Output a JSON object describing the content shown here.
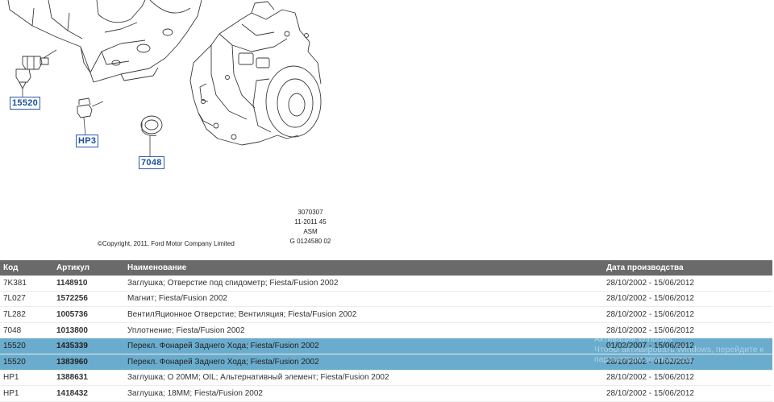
{
  "diagram": {
    "callouts": [
      "15520",
      "HP3",
      "7048"
    ],
    "stamp_lines": [
      "3070307",
      "11-2011 45",
      "ASM",
      "G 0124580 02"
    ],
    "copyright": "©Copyright, 2011, Ford Motor Company Limited"
  },
  "table": {
    "headers": {
      "code": "Код",
      "article": "Артикул",
      "name": "Наименование",
      "date": "Дата производства"
    },
    "rows": [
      {
        "code": "7K381",
        "article": "1148910",
        "name": "Заглушка; Отверстие под спидометр; Fiesta/Fusion 2002",
        "date": "28/10/2002 - 15/06/2012"
      },
      {
        "code": "7L027",
        "article": "1572256",
        "name": "Магнит; Fiesta/Fusion 2002",
        "date": "28/10/2002 - 15/06/2012"
      },
      {
        "code": "7L282",
        "article": "1005736",
        "name": "ВентилЯционное Отверстие; Вентиляция; Fiesta/Fusion 2002",
        "date": "28/10/2002 - 15/06/2012"
      },
      {
        "code": "7048",
        "article": "1013800",
        "name": "Уплотнение; Fiesta/Fusion 2002",
        "date": "28/10/2002 - 15/06/2012"
      },
      {
        "code": "15520",
        "article": "1435339",
        "name": "Перекл. Фонарей Заднего Хода; Fiesta/Fusion 2002",
        "date": "01/02/2007 - 15/06/2012"
      },
      {
        "code": "15520",
        "article": "1383960",
        "name": "Перекл. Фонарей Заднего Хода; Fiesta/Fusion 2002",
        "date": "28/10/2002 - 01/02/2007"
      },
      {
        "code": "HP1",
        "article": "1388631",
        "name": "Заглушка; О 20ММ; OIL; Альтернативный элемент; Fiesta/Fusion 2002",
        "date": "28/10/2002 - 15/06/2012"
      },
      {
        "code": "HP1",
        "article": "1418432",
        "name": "Заглушка; 18ММ; Fiesta/Fusion 2002",
        "date": "28/10/2002 - 15/06/2012"
      }
    ]
  },
  "watermark": [
    "Активация Windows",
    "Чтобы активировать Windows, перейдите к",
    "параметрам компьютера."
  ],
  "colors": {
    "header_bg": "#6a6a6a",
    "selected_bg": "#6aaccd",
    "callout_text": "#1a4f9c"
  }
}
